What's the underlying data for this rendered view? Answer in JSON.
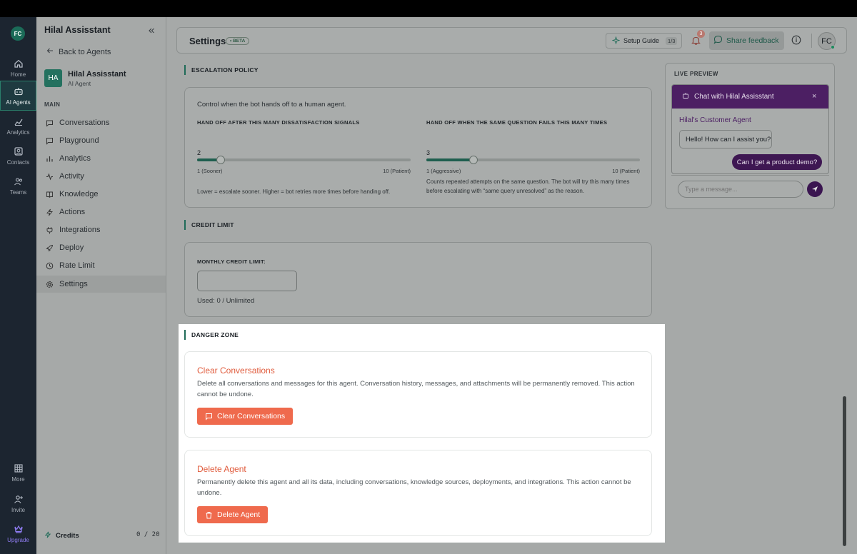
{
  "rail": {
    "avatar": "FC",
    "items": [
      {
        "label": "Home"
      },
      {
        "label": "AI Agents"
      },
      {
        "label": "Analytics"
      },
      {
        "label": "Contacts"
      },
      {
        "label": "Teams"
      },
      {
        "label": "More"
      },
      {
        "label": "Invite"
      },
      {
        "label": "Upgrade"
      }
    ]
  },
  "sidebar": {
    "title": "Hilal Assisstant",
    "back_label": "Back to Agents",
    "agent": {
      "initials": "HA",
      "name": "Hilal Assisstant",
      "type": "AI Agent"
    },
    "section": "MAIN",
    "items": [
      {
        "label": "Conversations"
      },
      {
        "label": "Playground"
      },
      {
        "label": "Analytics"
      },
      {
        "label": "Activity"
      },
      {
        "label": "Knowledge"
      },
      {
        "label": "Actions"
      },
      {
        "label": "Integrations"
      },
      {
        "label": "Deploy"
      },
      {
        "label": "Rate Limit"
      },
      {
        "label": "Settings"
      }
    ],
    "credits_label": "Credits",
    "credits_value": "0 / 20"
  },
  "header": {
    "title": "Settings",
    "badge": "• BETA",
    "setup_label": "Setup Guide",
    "setup_count": "1/3",
    "notif_count": "3",
    "feedback_label": "Share feedback",
    "user_initials": "FC"
  },
  "escalation": {
    "heading": "ESCALATION POLICY",
    "intro": "Control when the bot hands off to a human agent.",
    "dissatisfaction": {
      "label": "HAND OFF AFTER THIS MANY DISSATISFACTION SIGNALS",
      "value": "2",
      "level": 0.111,
      "min_label": "1 (Sooner)",
      "max_label": "10 (Patient)",
      "note": "Lower = escalate sooner. Higher = bot retries more times before handing off."
    },
    "same_question": {
      "label": "HAND OFF WHEN THE SAME QUESTION FAILS THIS MANY TIMES",
      "value": "3",
      "level": 0.222,
      "min_label": "1 (Aggressive)",
      "max_label": "10 (Patient)",
      "note": "Counts repeated attempts on the same question. The bot will try this many times before escalating with “same query unresolved” as the reason."
    }
  },
  "credit": {
    "heading": "CREDIT LIMIT",
    "label": "MONTHLY CREDIT LIMIT:",
    "value": "",
    "used": "Used: 0 / Unlimited"
  },
  "danger": {
    "heading": "DANGER ZONE",
    "clear": {
      "title": "Clear Conversations",
      "desc": "Delete all conversations and messages for this agent. Conversation history, messages, and attachments will be permanently removed. This action cannot be undone.",
      "button": "Clear Conversations"
    },
    "delete": {
      "title": "Delete Agent",
      "desc": "Permanently delete this agent and all its data, including conversations, knowledge sources, deployments, and integrations. This action cannot be undone.",
      "button": "Delete Agent"
    }
  },
  "preview": {
    "label": "LIVE PREVIEW",
    "chat_title": "Chat with Hilal Assisstant",
    "agent_name": "Hilal's Customer Agent",
    "bot_message": "Hello! How can I assist you?",
    "user_message": "Can I get a product demo?",
    "input_placeholder": "Type a message..."
  },
  "colors": {
    "accent": "#1f6b58",
    "danger": "#ef6a4d",
    "chat_brand": "#4c1f63"
  }
}
